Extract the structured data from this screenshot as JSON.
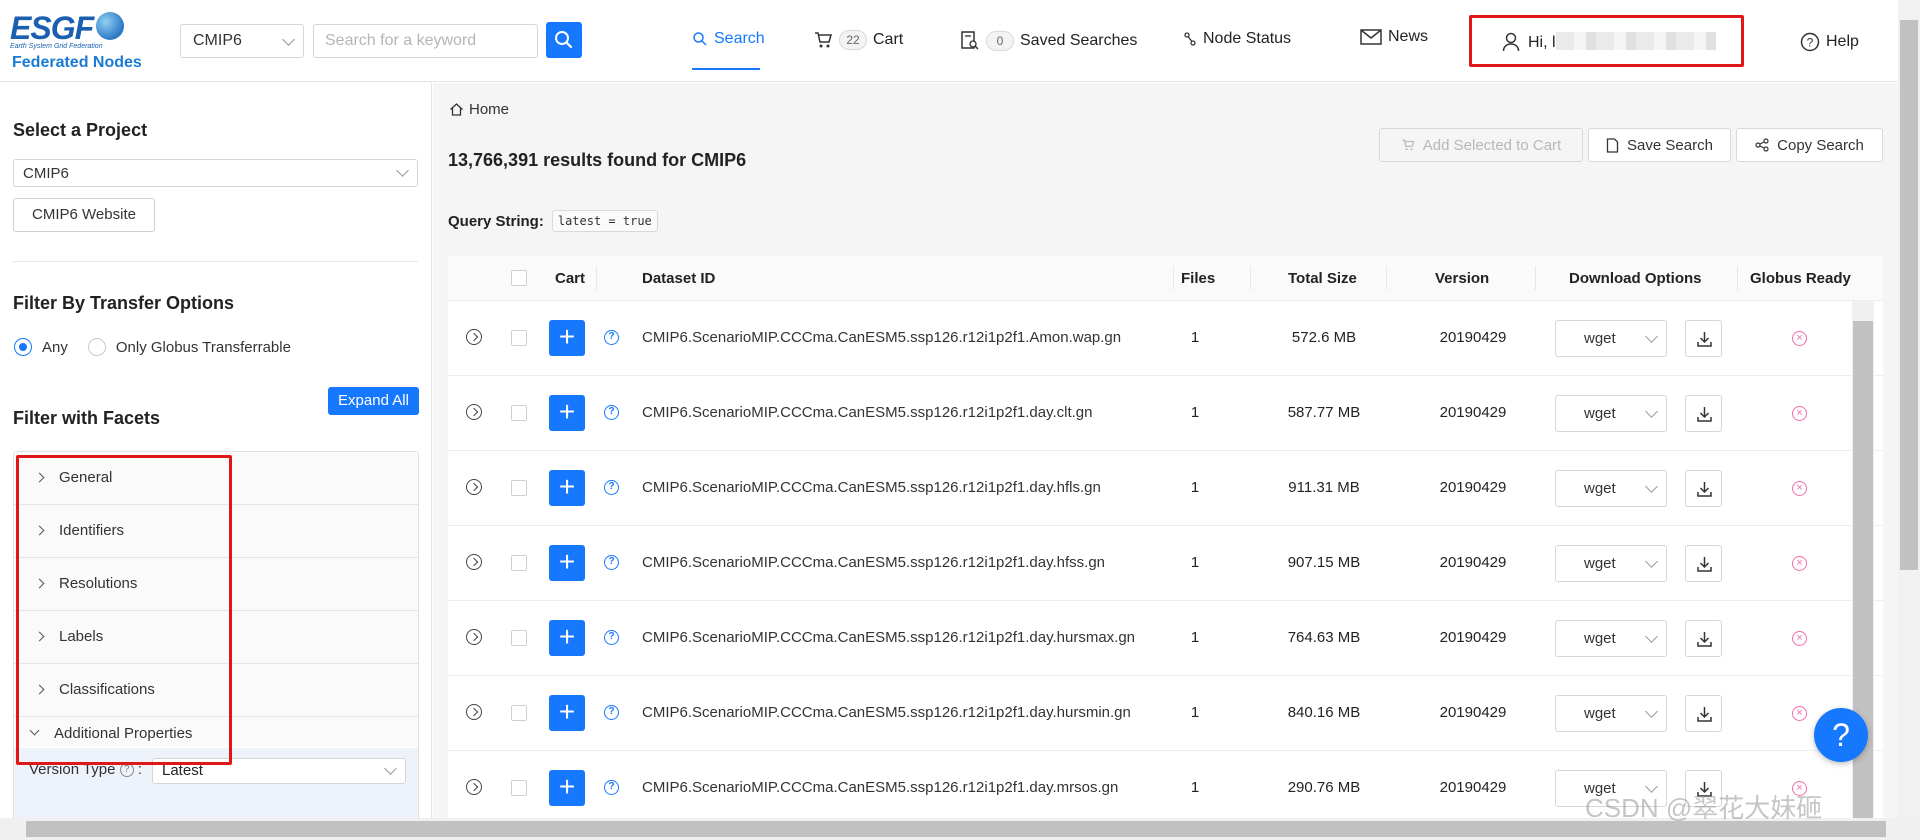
{
  "header": {
    "logo_text": "ESGF",
    "logo_tagline": "Earth System Grid Federation",
    "logo_subtitle": "Federated Nodes",
    "project_select": "CMIP6",
    "search_placeholder": "Search for a keyword",
    "nav": {
      "search": "Search",
      "cart": "Cart",
      "cart_count": "22",
      "saved_searches": "Saved Searches",
      "saved_count": "0",
      "node_status": "Node Status",
      "news": "News",
      "help": "Help"
    },
    "user_greeting": "Hi, l"
  },
  "sidebar": {
    "select_project_title": "Select a Project",
    "project_value": "CMIP6",
    "website_button": "CMIP6 Website",
    "transfer_title": "Filter By Transfer Options",
    "transfer_any": "Any",
    "transfer_globus": "Only Globus Transferrable",
    "facets_title": "Filter with Facets",
    "expand_all": "Expand All",
    "facets": [
      {
        "label": "General"
      },
      {
        "label": "Identifiers"
      },
      {
        "label": "Resolutions"
      },
      {
        "label": "Labels"
      },
      {
        "label": "Classifications"
      },
      {
        "label": "Additional Properties"
      }
    ],
    "version_type_label": "Version Type",
    "version_type_value": "Latest"
  },
  "main": {
    "breadcrumb": "Home",
    "results_text": "13,766,391 results found for CMIP6",
    "query_string_label": "Query String:",
    "query_string_value": "latest = true",
    "actions": {
      "add_to_cart": "Add Selected to Cart",
      "save_search": "Save Search",
      "copy_search": "Copy Search"
    },
    "columns": {
      "cart": "Cart",
      "dataset_id": "Dataset ID",
      "files": "Files",
      "total_size": "Total Size",
      "version": "Version",
      "download_options": "Download Options",
      "globus_ready": "Globus Ready"
    },
    "rows": [
      {
        "id": "CMIP6.ScenarioMIP.CCCma.CanESM5.ssp126.r12i1p2f1.Amon.wap.gn",
        "files": "1",
        "size": "572.6 MB",
        "version": "20190429",
        "download": "wget"
      },
      {
        "id": "CMIP6.ScenarioMIP.CCCma.CanESM5.ssp126.r12i1p2f1.day.clt.gn",
        "files": "1",
        "size": "587.77 MB",
        "version": "20190429",
        "download": "wget"
      },
      {
        "id": "CMIP6.ScenarioMIP.CCCma.CanESM5.ssp126.r12i1p2f1.day.hfls.gn",
        "files": "1",
        "size": "911.31 MB",
        "version": "20190429",
        "download": "wget"
      },
      {
        "id": "CMIP6.ScenarioMIP.CCCma.CanESM5.ssp126.r12i1p2f1.day.hfss.gn",
        "files": "1",
        "size": "907.15 MB",
        "version": "20190429",
        "download": "wget"
      },
      {
        "id": "CMIP6.ScenarioMIP.CCCma.CanESM5.ssp126.r12i1p2f1.day.hursmax.gn",
        "files": "1",
        "size": "764.63 MB",
        "version": "20190429",
        "download": "wget"
      },
      {
        "id": "CMIP6.ScenarioMIP.CCCma.CanESM5.ssp126.r12i1p2f1.day.hursmin.gn",
        "files": "1",
        "size": "840.16 MB",
        "version": "20190429",
        "download": "wget"
      },
      {
        "id": "CMIP6.ScenarioMIP.CCCma.CanESM5.ssp126.r12i1p2f1.day.mrsos.gn",
        "files": "1",
        "size": "290.76 MB",
        "version": "20190429",
        "download": "wget"
      }
    ]
  },
  "watermark": "CSDN @翠花大妹砸",
  "colors": {
    "accent": "#1677ff",
    "highlight_box": "#e01717",
    "globus_icon": "#f06ea9"
  }
}
